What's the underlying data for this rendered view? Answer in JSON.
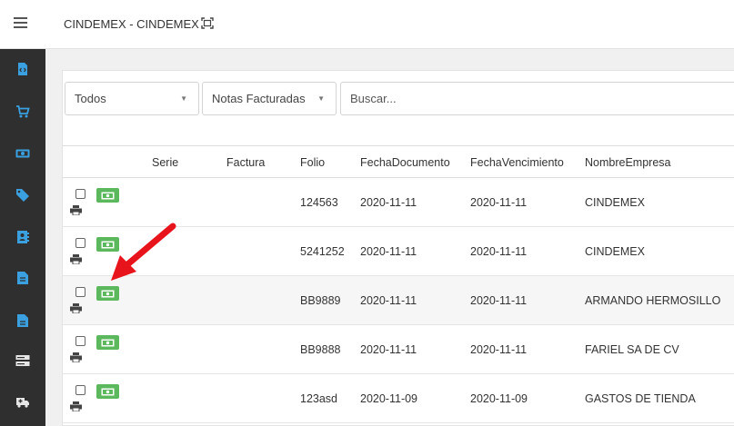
{
  "header": {
    "title": "CINDEMEX - CINDEMEX"
  },
  "sidebar": {
    "items": [
      {
        "icon": "code-file-icon"
      },
      {
        "icon": "cart-icon"
      },
      {
        "icon": "money-icon"
      },
      {
        "icon": "tags-icon"
      },
      {
        "icon": "contacts-book-icon"
      },
      {
        "icon": "document-icon"
      },
      {
        "icon": "document-alt-icon"
      },
      {
        "icon": "server-icon"
      },
      {
        "icon": "ambulance-icon"
      }
    ],
    "accent_color": "#3aa0e0"
  },
  "filters": {
    "status_value": "Todos",
    "type_value": "Notas Facturadas",
    "search_placeholder": "Buscar..."
  },
  "table": {
    "columns": {
      "serie": "Serie",
      "factura": "Factura",
      "folio": "Folio",
      "fecha_documento": "FechaDocumento",
      "fecha_vencimiento": "FechaVencimiento",
      "nombre_empresa": "NombreEmpresa"
    },
    "rows": [
      {
        "serie": "",
        "factura": "",
        "folio": "124563",
        "fecha_documento": "2020-11-11",
        "fecha_vencimiento": "2020-11-11",
        "nombre_empresa": "CINDEMEX"
      },
      {
        "serie": "",
        "factura": "",
        "folio": "5241252",
        "fecha_documento": "2020-11-11",
        "fecha_vencimiento": "2020-11-11",
        "nombre_empresa": "CINDEMEX"
      },
      {
        "serie": "",
        "factura": "",
        "folio": "BB9889",
        "fecha_documento": "2020-11-11",
        "fecha_vencimiento": "2020-11-11",
        "nombre_empresa": "ARMANDO HERMOSILLO"
      },
      {
        "serie": "",
        "factura": "",
        "folio": "BB9888",
        "fecha_documento": "2020-11-11",
        "fecha_vencimiento": "2020-11-11",
        "nombre_empresa": "FARIEL SA DE CV"
      },
      {
        "serie": "",
        "factura": "",
        "folio": "123asd",
        "fecha_documento": "2020-11-09",
        "fecha_vencimiento": "2020-11-09",
        "nombre_empresa": "GASTOS DE TIENDA"
      }
    ],
    "pay_button_color": "#5cb85c",
    "annotation_color": "#e8141b"
  }
}
